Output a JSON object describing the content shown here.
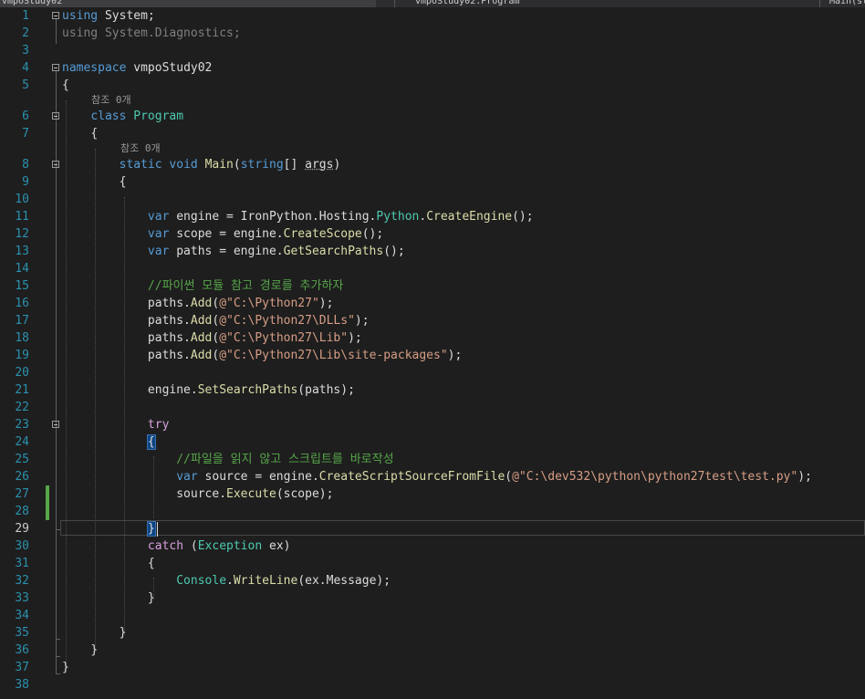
{
  "tabs": {
    "navigation": "vmpoStudy02",
    "class": "vmpoStudy02.Program",
    "member": "Main(st"
  },
  "line_numbers": [
    "1",
    "2",
    "3",
    "4",
    "5",
    "6",
    "7",
    "8",
    "9",
    "10",
    "11",
    "12",
    "13",
    "14",
    "15",
    "16",
    "17",
    "18",
    "19",
    "20",
    "21",
    "22",
    "23",
    "24",
    "25",
    "26",
    "27",
    "28",
    "29",
    "30",
    "31",
    "32",
    "33",
    "34",
    "35",
    "36",
    "37",
    "38"
  ],
  "active_line_number": "29",
  "lens": {
    "class_refs": "참조 0개",
    "main_refs": "참조 0개"
  },
  "code": {
    "l1": {
      "kw": "using",
      "rest": " System;"
    },
    "l2": {
      "kw": "using",
      "rest": " System.Diagnostics;"
    },
    "l4": {
      "kw": "namespace",
      "rest": " vmpoStudy02"
    },
    "l5": "{",
    "l6": {
      "kw": "class",
      "type": "Program"
    },
    "l7": "{",
    "l8": {
      "kw1": "static",
      "kw2": "void",
      "method": "Main",
      "open": "(",
      "kw3": "string",
      "mid": "[] ",
      "param": "args",
      "close": ")"
    },
    "l9": "{",
    "l11": {
      "kw": "var",
      "a": " engine = IronPython.Hosting.",
      "type": "Python",
      "dot": ".",
      "method": "CreateEngine",
      "end": "();"
    },
    "l12": {
      "kw": "var",
      "a": " scope = engine.",
      "method": "CreateScope",
      "end": "();"
    },
    "l13": {
      "kw": "var",
      "a": " paths = engine.",
      "method": "GetSearchPaths",
      "end": "();"
    },
    "l15": "//파이썬 모듈 참고 경로를 추가하자",
    "l16": {
      "a": "paths.",
      "method": "Add",
      "open": "(",
      "str": "@\"C:\\Python27\"",
      "end": ");"
    },
    "l17": {
      "a": "paths.",
      "method": "Add",
      "open": "(",
      "str": "@\"C:\\Python27\\DLLs\"",
      "end": ");"
    },
    "l18": {
      "a": "paths.",
      "method": "Add",
      "open": "(",
      "str": "@\"C:\\Python27\\Lib\"",
      "end": ");"
    },
    "l19": {
      "a": "paths.",
      "method": "Add",
      "open": "(",
      "str": "@\"C:\\Python27\\Lib\\site-packages\"",
      "end": ");"
    },
    "l21": {
      "a": "engine.",
      "method": "SetSearchPaths",
      "end": "(paths);"
    },
    "l23": "try",
    "l24": "{",
    "l25": "//파일을 읽지 않고 스크립트를 바로작성",
    "l26": {
      "kw": "var",
      "a": " source = engine.",
      "method": "CreateScriptSourceFromFile",
      "open": "(",
      "str": "@\"C:\\dev532\\python\\python27test\\test.py\"",
      "end": ");"
    },
    "l27": {
      "a": "source.",
      "method": "Execute",
      "end": "(scope);"
    },
    "l29": "}",
    "l30": {
      "kw": "catch",
      "a": " (",
      "type": "Exception",
      "end": " ex)"
    },
    "l31": "{",
    "l32": {
      "type": "Console",
      "dot": ".",
      "method": "WriteLine",
      "end": "(ex.Message);"
    },
    "l33": "}",
    "l35": "}",
    "l36": "}",
    "l37": "}"
  },
  "colors": {
    "background": "#1e1e1e",
    "line_number": "#2b91af",
    "keyword": "#569cd6",
    "control_keyword": "#d8a0df",
    "type": "#4ec9b0",
    "method": "#dcdcaa",
    "string": "#d69d85",
    "comment": "#57a64a",
    "change_bar": "#57a64a"
  }
}
